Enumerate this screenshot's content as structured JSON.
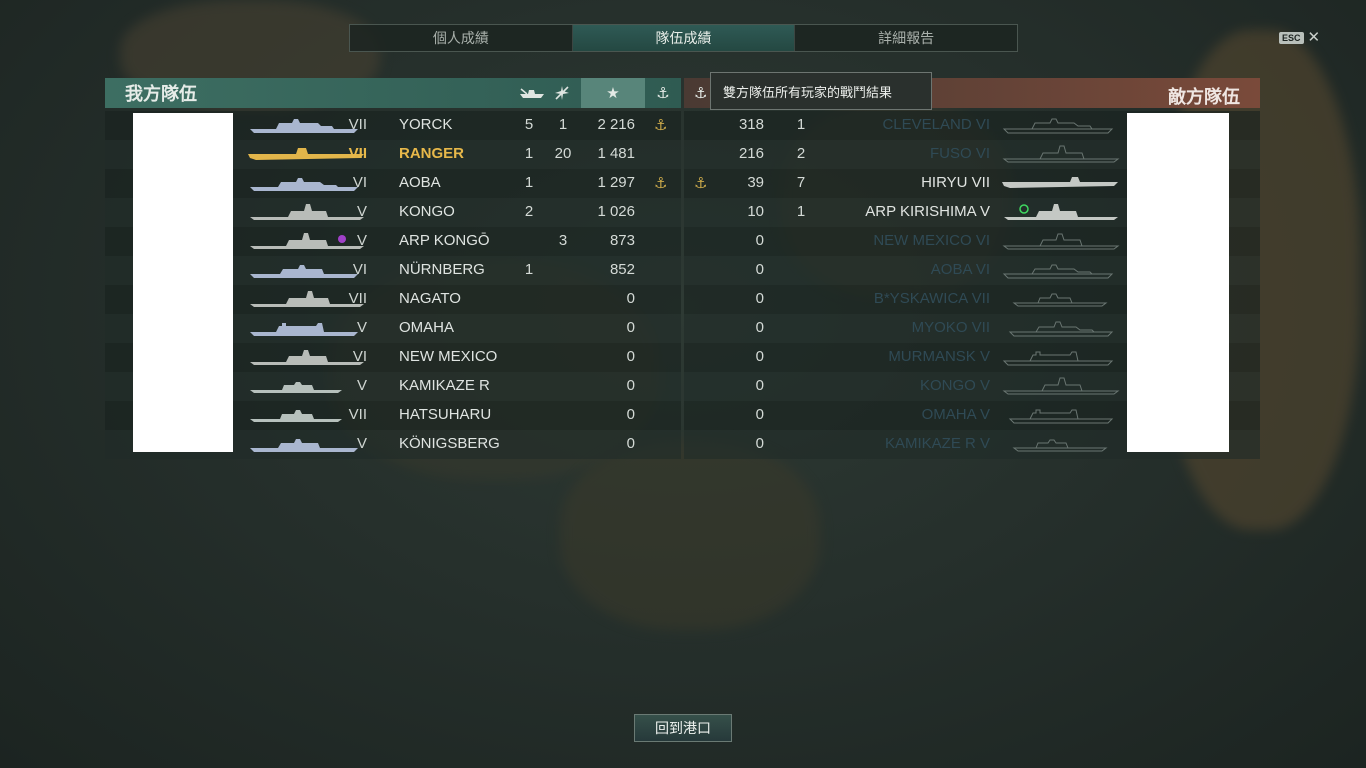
{
  "tabs": [
    "個人成績",
    "隊伍成績",
    "詳細報告"
  ],
  "active_tab": 1,
  "esc_key": "ESC",
  "close_glyph": "✕",
  "left_team": {
    "title": "我方隊伍",
    "accent": "#3d6e62"
  },
  "right_team": {
    "title": "敵方隊伍",
    "accent": "#7a4a3a"
  },
  "column_icons": {
    "ships_destroyed": "ship-sunk-icon",
    "planes_destroyed": "planes-shot-down-icon",
    "score": "★",
    "anchor": "⚓"
  },
  "tooltip": "雙方隊伍所有玩家的戰鬥結果",
  "left_rows": [
    {
      "tier": "VII",
      "name": "YORCK",
      "ships": "5",
      "planes": "1",
      "score": "2 216",
      "anchor": "⚓",
      "me": false
    },
    {
      "tier": "VII",
      "name": "RANGER",
      "ships": "1",
      "planes": "20",
      "score": "1 481",
      "anchor": "",
      "me": true
    },
    {
      "tier": "VI",
      "name": "AOBA",
      "ships": "1",
      "planes": "",
      "score": "1 297",
      "anchor": "⚓",
      "me": false
    },
    {
      "tier": "V",
      "name": "KONGO",
      "ships": "2",
      "planes": "",
      "score": "1 026",
      "anchor": "",
      "me": false
    },
    {
      "tier": "V",
      "name": "ARP  KONGŌ",
      "ships": "",
      "planes": "3",
      "score": "873",
      "anchor": "",
      "me": false
    },
    {
      "tier": "VI",
      "name": "NÜRNBERG",
      "ships": "1",
      "planes": "",
      "score": "852",
      "anchor": "",
      "me": false
    },
    {
      "tier": "VII",
      "name": "NAGATO",
      "ships": "",
      "planes": "",
      "score": "0",
      "anchor": "",
      "me": false
    },
    {
      "tier": "V",
      "name": "OMAHA",
      "ships": "",
      "planes": "",
      "score": "0",
      "anchor": "",
      "me": false
    },
    {
      "tier": "VI",
      "name": "NEW  MEXICO",
      "ships": "",
      "planes": "",
      "score": "0",
      "anchor": "",
      "me": false
    },
    {
      "tier": "V",
      "name": "KAMIKAZE  R",
      "ships": "",
      "planes": "",
      "score": "0",
      "anchor": "",
      "me": false
    },
    {
      "tier": "VII",
      "name": "HATSUHARU",
      "ships": "",
      "planes": "",
      "score": "0",
      "anchor": "",
      "me": false
    },
    {
      "tier": "V",
      "name": "KÖNIGSBERG",
      "ships": "",
      "planes": "",
      "score": "0",
      "anchor": "",
      "me": false
    }
  ],
  "right_rows": [
    {
      "anchor": "",
      "score": "318",
      "kills": "1",
      "name": "CLEVELAND   VI",
      "dead": true
    },
    {
      "anchor": "",
      "score": "216",
      "kills": "2",
      "name": "FUSO   VI",
      "dead": true
    },
    {
      "anchor": "⚓",
      "score": "39",
      "kills": "7",
      "name": "HIRYU   VII",
      "dead": false
    },
    {
      "anchor": "",
      "score": "10",
      "kills": "1",
      "name": "ARP  KIRISHIMA   V",
      "dead": false
    },
    {
      "anchor": "",
      "score": "0",
      "kills": "",
      "name": "NEW  MEXICO   VI",
      "dead": true
    },
    {
      "anchor": "",
      "score": "0",
      "kills": "",
      "name": "AOBA   VI",
      "dead": true
    },
    {
      "anchor": "",
      "score": "0",
      "kills": "",
      "name": "B*YSKAWICA   VII",
      "dead": true
    },
    {
      "anchor": "",
      "score": "0",
      "kills": "",
      "name": "MYOKO   VII",
      "dead": true
    },
    {
      "anchor": "",
      "score": "0",
      "kills": "",
      "name": "MURMANSK   V",
      "dead": true
    },
    {
      "anchor": "",
      "score": "0",
      "kills": "",
      "name": "KONGO   V",
      "dead": true
    },
    {
      "anchor": "",
      "score": "0",
      "kills": "",
      "name": "OMAHA   V",
      "dead": true
    },
    {
      "anchor": "",
      "score": "0",
      "kills": "",
      "name": "KAMIKAZE  R   V",
      "dead": true
    }
  ],
  "return_button": "回到港口"
}
